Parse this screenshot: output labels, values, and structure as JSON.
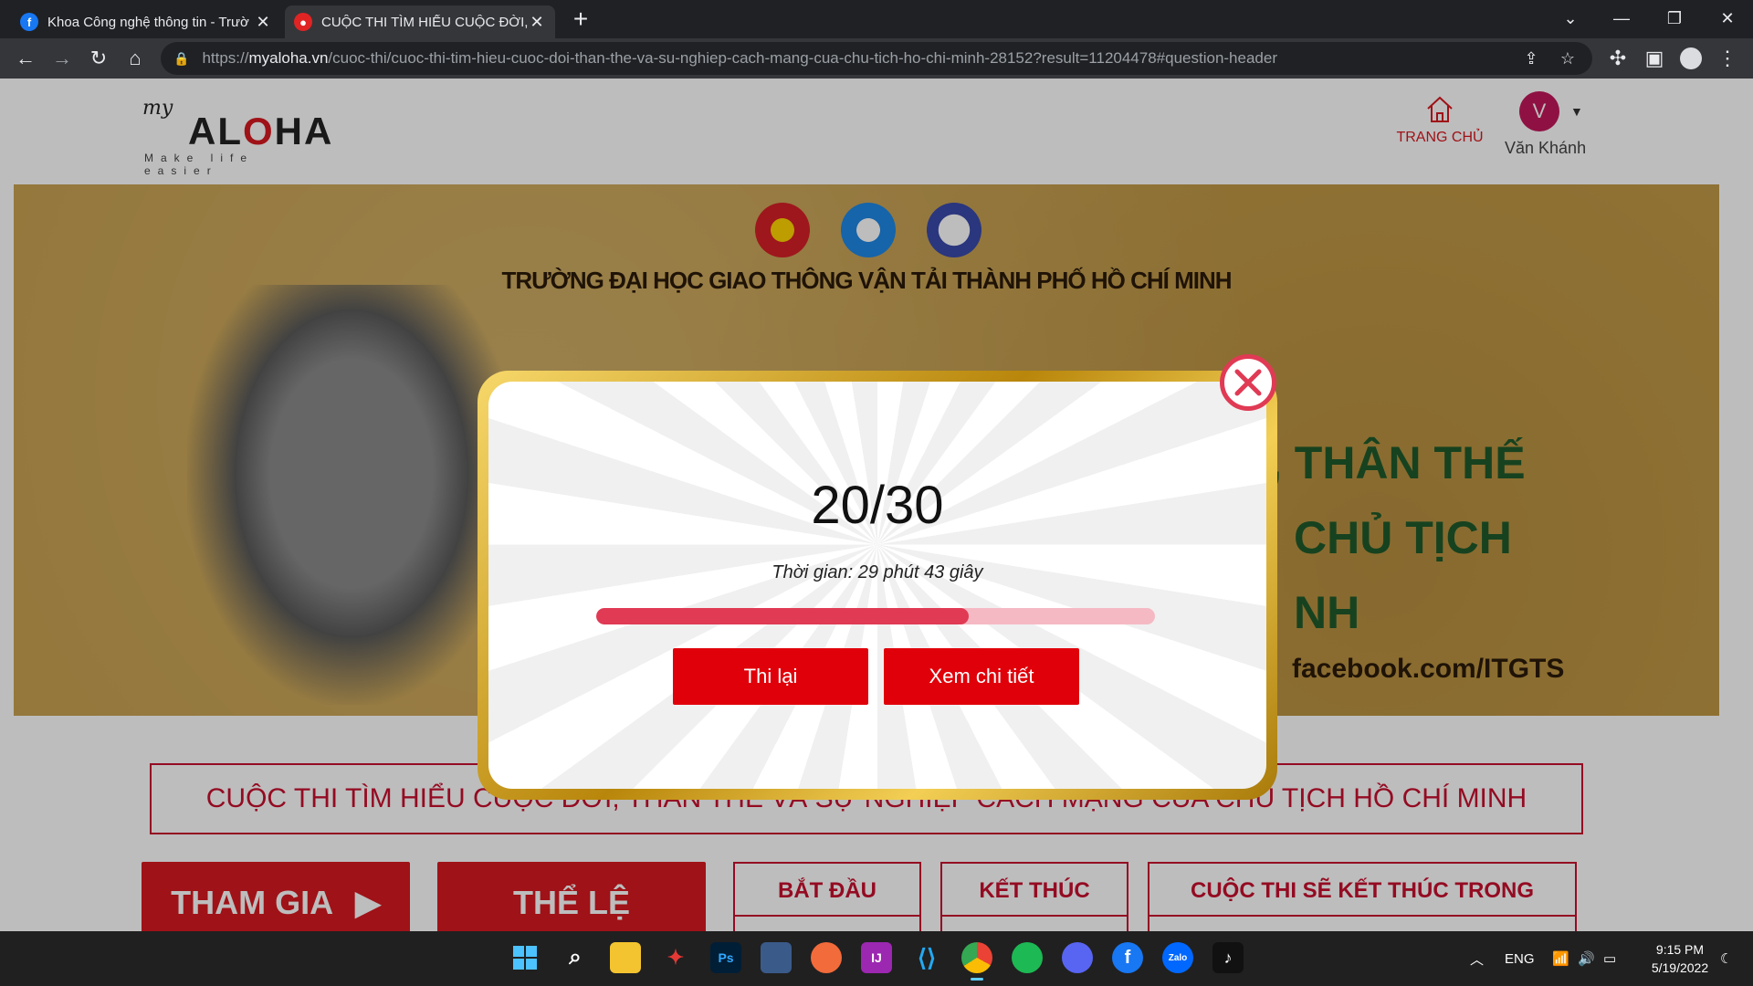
{
  "browser": {
    "tabs": [
      {
        "title": "Khoa Công nghệ thông tin - Trườ",
        "favicon": "facebook-icon",
        "active": false
      },
      {
        "title": "CUỘC THI TÌM HIỂU CUỘC ĐỜI, T",
        "favicon": "myaloha-icon",
        "active": true
      }
    ],
    "url_prefix": "https://",
    "url_domain": "myaloha.vn",
    "url_path": "/cuoc-thi/cuoc-thi-tim-hieu-cuoc-doi-than-the-va-su-nghiep-cach-mang-cua-chu-tich-ho-chi-minh-28152?result=11204478#question-header"
  },
  "header": {
    "logo_my": "my",
    "logo_aloha_pre": "AL",
    "logo_aloha_o": "O",
    "logo_aloha_post": "HA",
    "logo_tagline": "Make life easier",
    "home_label": "TRANG CHỦ",
    "user_initial": "V",
    "user_name": "Văn Khánh"
  },
  "banner": {
    "school": "TRƯỜNG ĐẠI HỌC GIAO THÔNG VẬN TẢI THÀNH PHỐ HỒ CHÍ MINH",
    "line1": ", THÂN THẾ",
    "line2": "CHỦ TỊCH",
    "line3": "NH",
    "facebook": "facebook.com/ITGTS"
  },
  "modal": {
    "score": "20/30",
    "time": "Thời gian: 29 phút 43 giây",
    "progress_fraction": 0.6667,
    "retry_label": "Thi lại",
    "detail_label": "Xem chi tiết"
  },
  "contest": {
    "title": "CUỘC THI TÌM HIỂU CUỘC ĐỜI, THÂN THẾ VÀ SỰ NGHIỆP CÁCH MẠNG CỦA CHỦ TỊCH HỒ CHÍ MINH",
    "join_label": "THAM GIA",
    "rules_label": "THỂ LỆ",
    "start_label": "BẮT ĐẦU",
    "end_label": "KẾT THÚC",
    "countdown_label": "CUỘC THI SẼ KẾT THÚC TRONG"
  },
  "taskbar": {
    "language": "ENG",
    "time": "9:15 PM",
    "date": "5/19/2022",
    "apps": [
      "start-icon",
      "search-icon",
      "file-explorer-icon",
      "app-icon",
      "photoshop-icon",
      "app-icon",
      "app-icon",
      "intellij-icon",
      "vscode-icon",
      "chrome-icon",
      "spotify-icon",
      "discord-icon",
      "facebook-icon",
      "zalo-icon",
      "tiktok-icon"
    ],
    "ps_label": "Ps",
    "zalo_label": "Zalo"
  },
  "colors": {
    "accent_red": "#d71920",
    "progress_fill": "#e03a54",
    "progress_track": "#f5b9c4",
    "gold": "#d4a62a",
    "banner_bg": "#c79f4b"
  }
}
